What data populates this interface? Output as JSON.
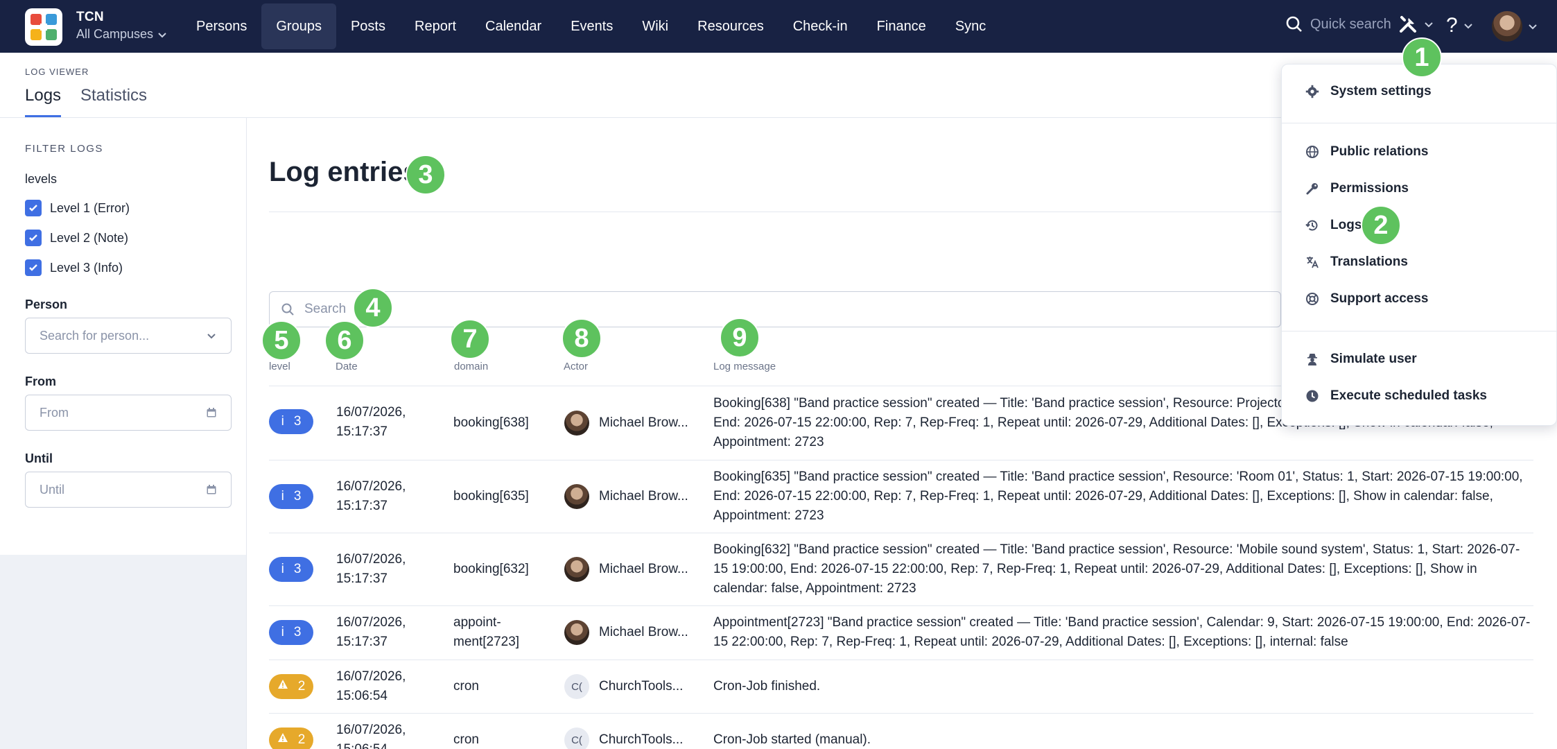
{
  "app": {
    "org_name": "TCN",
    "campus": "All Campuses",
    "quick_search": "Quick search"
  },
  "nav": [
    "Persons",
    "Groups",
    "Posts",
    "Report",
    "Calendar",
    "Events",
    "Wiki",
    "Resources",
    "Check-in",
    "Finance",
    "Sync"
  ],
  "nav_active": "Groups",
  "subheader": {
    "crumb": "LOG VIEWER",
    "tabs": [
      "Logs",
      "Statistics"
    ]
  },
  "filters": {
    "heading": "FILTER LOGS",
    "levels_label": "levels",
    "levels": [
      "Level 1 (Error)",
      "Level 2 (Note)",
      "Level 3 (Info)"
    ],
    "person_label": "Person",
    "person_placeholder": "Search for person...",
    "from_label": "From",
    "from_placeholder": "From",
    "until_label": "Until",
    "until_placeholder": "Until"
  },
  "main": {
    "title": "Log entries",
    "search_placeholder": "Search",
    "columns": [
      "level",
      "Date",
      "domain",
      "Actor",
      "Log message"
    ]
  },
  "rows": [
    {
      "level": "3",
      "type": "info",
      "date1": "16/07/2026,",
      "date2": "15:17:37",
      "domain1": "booking[638]",
      "domain2": "",
      "actor": "Michael Brow...",
      "actor_initials": "",
      "msg": "Booking[638] \"Band practice session\" created — Title: 'Band practice session', Resource: Projector, Status: 1, Start: 2026-07-15 19:00:00, End: 2026-07-15 22:00:00, Rep: 7, Rep-Freq: 1, Repeat until: 2026-07-29, Additional Dates: [], Exceptions: [], Show in calendar: false, Appointment: 2723"
    },
    {
      "level": "3",
      "type": "info",
      "date1": "16/07/2026,",
      "date2": "15:17:37",
      "domain1": "booking[635]",
      "domain2": "",
      "actor": "Michael Brow...",
      "actor_initials": "",
      "msg": "Booking[635] \"Band practice session\" created — Title: 'Band practice session', Resource: 'Room 01', Status: 1, Start: 2026-07-15 19:00:00, End: 2026-07-15 22:00:00, Rep: 7, Rep-Freq: 1, Repeat until: 2026-07-29, Additional Dates: [], Exceptions: [], Show in calendar: false, Appointment: 2723"
    },
    {
      "level": "3",
      "type": "info",
      "date1": "16/07/2026,",
      "date2": "15:17:37",
      "domain1": "booking[632]",
      "domain2": "",
      "actor": "Michael Brow...",
      "actor_initials": "",
      "msg": "Booking[632] \"Band practice session\" created — Title: 'Band practice session', Resource: 'Mobile sound system', Status: 1, Start: 2026-07-15 19:00:00, End: 2026-07-15 22:00:00, Rep: 7, Rep-Freq: 1, Repeat until: 2026-07-29, Additional Dates: [], Exceptions: [], Show in calendar: false, Appointment: 2723"
    },
    {
      "level": "3",
      "type": "info",
      "date1": "16/07/2026,",
      "date2": "15:17:37",
      "domain1": "appoint-",
      "domain2": "ment[2723]",
      "actor": "Michael Brow...",
      "actor_initials": "",
      "msg": "Appointment[2723] \"Band practice session\" created — Title: 'Band practice session', Calendar: 9, Start: 2026-07-15 19:00:00, End: 2026-07-15 22:00:00, Rep: 7, Rep-Freq: 1, Repeat until: 2026-07-29, Additional Dates: [], Exceptions: [], internal: false"
    },
    {
      "level": "2",
      "type": "warn",
      "date1": "16/07/2026,",
      "date2": "15:06:54",
      "domain1": "cron",
      "domain2": "",
      "actor": "ChurchTools...",
      "actor_initials": "C(",
      "msg": "Cron-Job finished."
    },
    {
      "level": "2",
      "type": "warn",
      "date1": "16/07/2026,",
      "date2": "15:06:54",
      "domain1": "cron",
      "domain2": "",
      "actor": "ChurchTools...",
      "actor_initials": "C(",
      "msg": "Cron-Job started (manual)."
    }
  ],
  "menu": {
    "items": [
      "System settings",
      "Public relations",
      "Permissions",
      "Logs",
      "Translations",
      "Support access",
      "Simulate user",
      "Execute scheduled tasks"
    ]
  },
  "markers": [
    "1",
    "2",
    "3",
    "4",
    "5",
    "6",
    "7",
    "8",
    "9"
  ],
  "colors": {
    "topbar": "#182243",
    "accent": "#3f6fe3",
    "warn": "#e6a92b",
    "marker": "#5ec25e"
  }
}
